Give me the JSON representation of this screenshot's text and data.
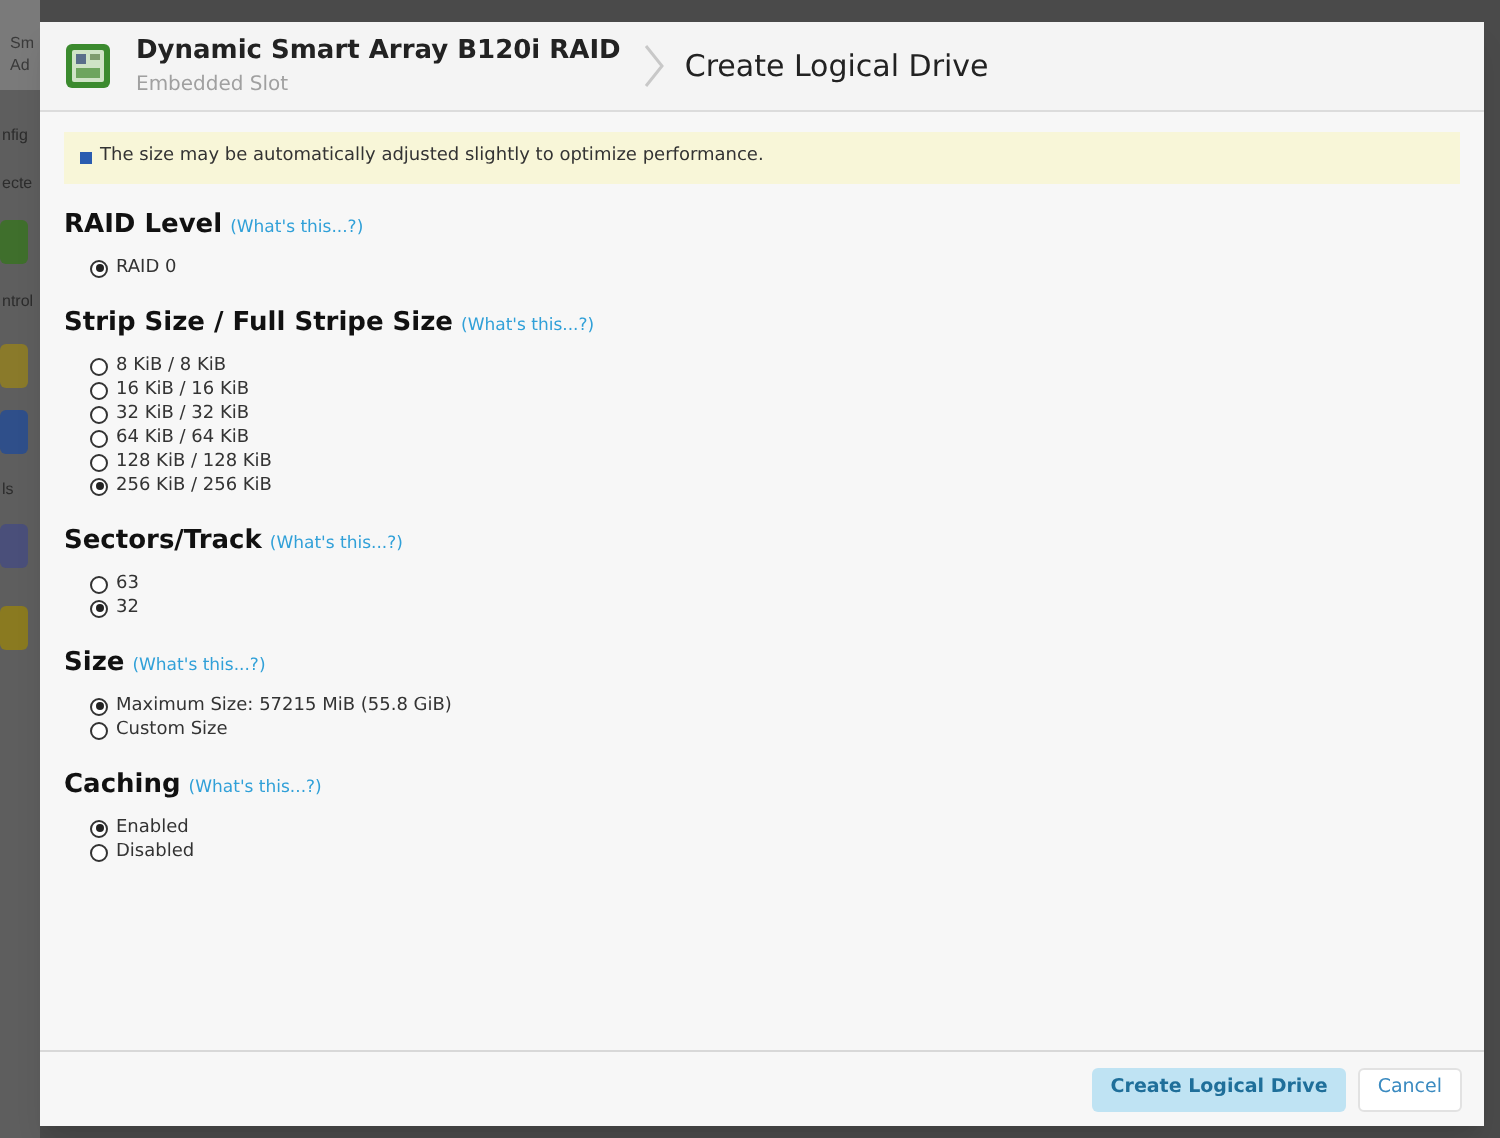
{
  "background": {
    "texts": [
      "Sm",
      "Ad",
      "nfig",
      "ecte",
      "ntrol",
      "ls"
    ]
  },
  "dialog": {
    "device": {
      "name": "Dynamic Smart Array B120i RAID",
      "slot": "Embedded Slot"
    },
    "title": "Create Logical Drive",
    "notice": "The size may be automatically adjusted slightly to optimize performance.",
    "sections": [
      {
        "heading": "RAID Level",
        "help": "(What's this...?)",
        "options": [
          {
            "label": "RAID 0",
            "selected": true
          }
        ]
      },
      {
        "heading": "Strip Size / Full Stripe Size",
        "help": "(What's this...?)",
        "options": [
          {
            "label": "8 KiB / 8 KiB",
            "selected": false
          },
          {
            "label": "16 KiB / 16 KiB",
            "selected": false
          },
          {
            "label": "32 KiB / 32 KiB",
            "selected": false
          },
          {
            "label": "64 KiB / 64 KiB",
            "selected": false
          },
          {
            "label": "128 KiB / 128 KiB",
            "selected": false
          },
          {
            "label": "256 KiB / 256 KiB",
            "selected": true
          }
        ]
      },
      {
        "heading": "Sectors/Track",
        "help": "(What's this...?)",
        "options": [
          {
            "label": "63",
            "selected": false
          },
          {
            "label": "32",
            "selected": true
          }
        ]
      },
      {
        "heading": "Size",
        "help": "(What's this...?)",
        "options": [
          {
            "label": "Maximum Size: 57215 MiB (55.8 GiB)",
            "selected": true
          },
          {
            "label": "Custom Size",
            "selected": false
          }
        ]
      },
      {
        "heading": "Caching",
        "help": "(What's this...?)",
        "options": [
          {
            "label": "Enabled",
            "selected": true
          },
          {
            "label": "Disabled",
            "selected": false
          }
        ]
      }
    ],
    "buttons": [
      {
        "label": "Create Logical Drive",
        "kind": "primary"
      },
      {
        "label": "Cancel",
        "kind": "secondary"
      }
    ]
  }
}
